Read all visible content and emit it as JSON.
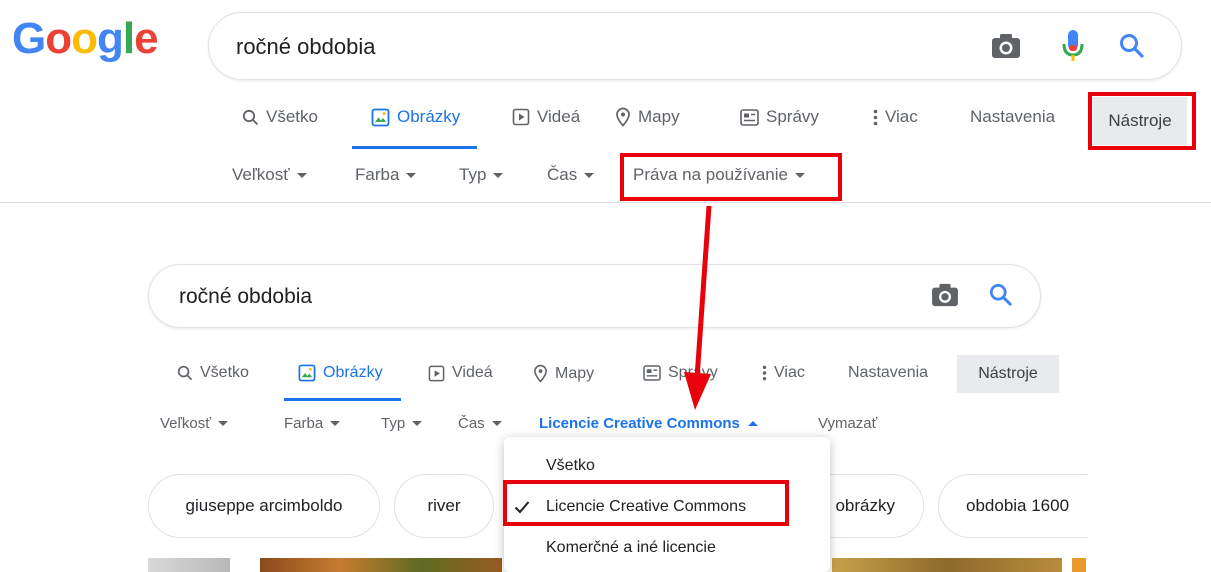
{
  "logo": {
    "letters": [
      "G",
      "o",
      "o",
      "g",
      "l",
      "e"
    ],
    "colors": [
      "#4285F4",
      "#EA4335",
      "#FBBC05",
      "#4285F4",
      "#34A853",
      "#EA4335"
    ]
  },
  "top": {
    "search": {
      "query": "ročné obdobia"
    },
    "tabs": [
      {
        "label": "Všetko",
        "icon": "search-icon"
      },
      {
        "label": "Obrázky",
        "icon": "image-icon"
      },
      {
        "label": "Videá",
        "icon": "play-icon"
      },
      {
        "label": "Mapy",
        "icon": "map-pin-icon"
      },
      {
        "label": "Správy",
        "icon": "news-icon"
      },
      {
        "label": "Viac",
        "icon": "more-vert-icon"
      }
    ],
    "settings_label": "Nastavenia",
    "tools_label": "Nástroje",
    "filters": [
      {
        "label": "Veľkosť"
      },
      {
        "label": "Farba"
      },
      {
        "label": "Typ"
      },
      {
        "label": "Čas"
      },
      {
        "label": "Práva na používanie"
      }
    ]
  },
  "bottom": {
    "search": {
      "query": "ročné obdobia"
    },
    "tabs": [
      {
        "label": "Všetko"
      },
      {
        "label": "Obrázky"
      },
      {
        "label": "Videá"
      },
      {
        "label": "Mapy"
      },
      {
        "label": "Správy"
      },
      {
        "label": "Viac"
      }
    ],
    "settings_label": "Nastavenia",
    "tools_label": "Nástroje",
    "filters": [
      {
        "label": "Veľkosť"
      },
      {
        "label": "Farba"
      },
      {
        "label": "Typ"
      },
      {
        "label": "Čas"
      }
    ],
    "active_filter": "Licencie Creative Commons",
    "clear_label": "Vymazať",
    "chips": [
      "giuseppe arcimboldo",
      "river",
      "obrázky",
      "obdobia 1600"
    ],
    "dropdown": {
      "items": [
        "Všetko",
        "Licencie Creative Commons",
        "Komerčné a iné licencie"
      ],
      "selected": "Licencie Creative Commons"
    }
  },
  "colors": {
    "accent": "#1a73e8",
    "highlight": "#e8000b"
  }
}
